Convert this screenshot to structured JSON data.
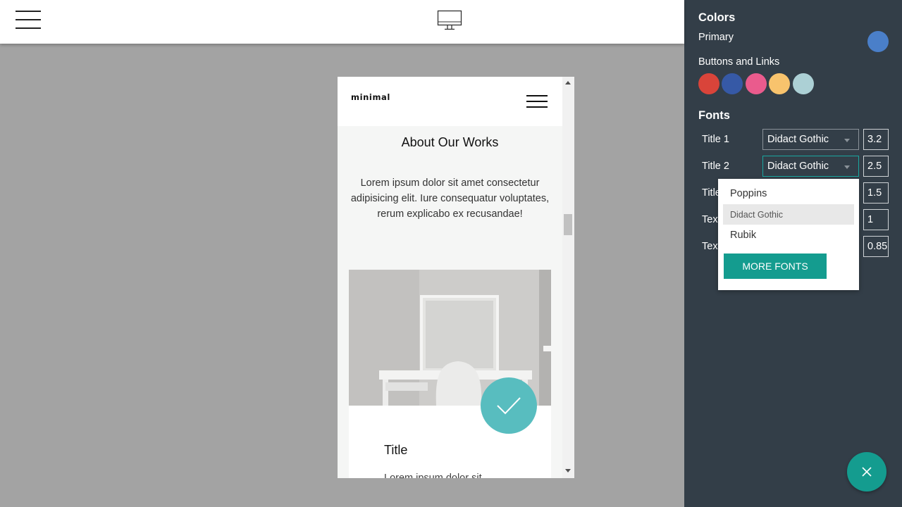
{
  "topbar": {
    "menu_icon": "hamburger-menu-icon",
    "device_icon": "desktop-monitor-icon"
  },
  "preview": {
    "brand": "minimal",
    "section_title": "About Our Works",
    "section_text": "Lorem ipsum dolor sit amet consectetur adipisicing elit. Iure consequatur voluptates, rerum explicabo ex recusandae!",
    "card_title": "Title",
    "card_text": "Lorem ipsum dolor sit",
    "badge_icon": "checkmark-icon"
  },
  "panel": {
    "colors_heading": "Colors",
    "primary_label": "Primary",
    "primary_color": "#4a7fc9",
    "buttons_links_label": "Buttons and Links",
    "swatches": [
      "#d9443a",
      "#3659a6",
      "#ea5b8d",
      "#f8c36d",
      "#acd0d5"
    ],
    "fonts_heading": "Fonts",
    "font_rows": [
      {
        "label": "Title 1",
        "font": "Didact Gothic",
        "size": "3.2"
      },
      {
        "label": "Title 2",
        "font": "Didact Gothic",
        "size": "2.5"
      },
      {
        "label": "Title",
        "size": "1.5"
      },
      {
        "label": "Text",
        "size": "1"
      },
      {
        "label": "Text",
        "size": "0.85"
      }
    ],
    "dropdown": {
      "options": [
        "Poppins",
        "Didact Gothic",
        "Rubik"
      ],
      "selected": "Didact Gothic",
      "more_label": "MORE FONTS"
    },
    "fab_icon": "close-icon"
  },
  "colors": {
    "panel_bg": "#333e48",
    "accent": "#149c8f",
    "badge": "#58bdbf"
  }
}
